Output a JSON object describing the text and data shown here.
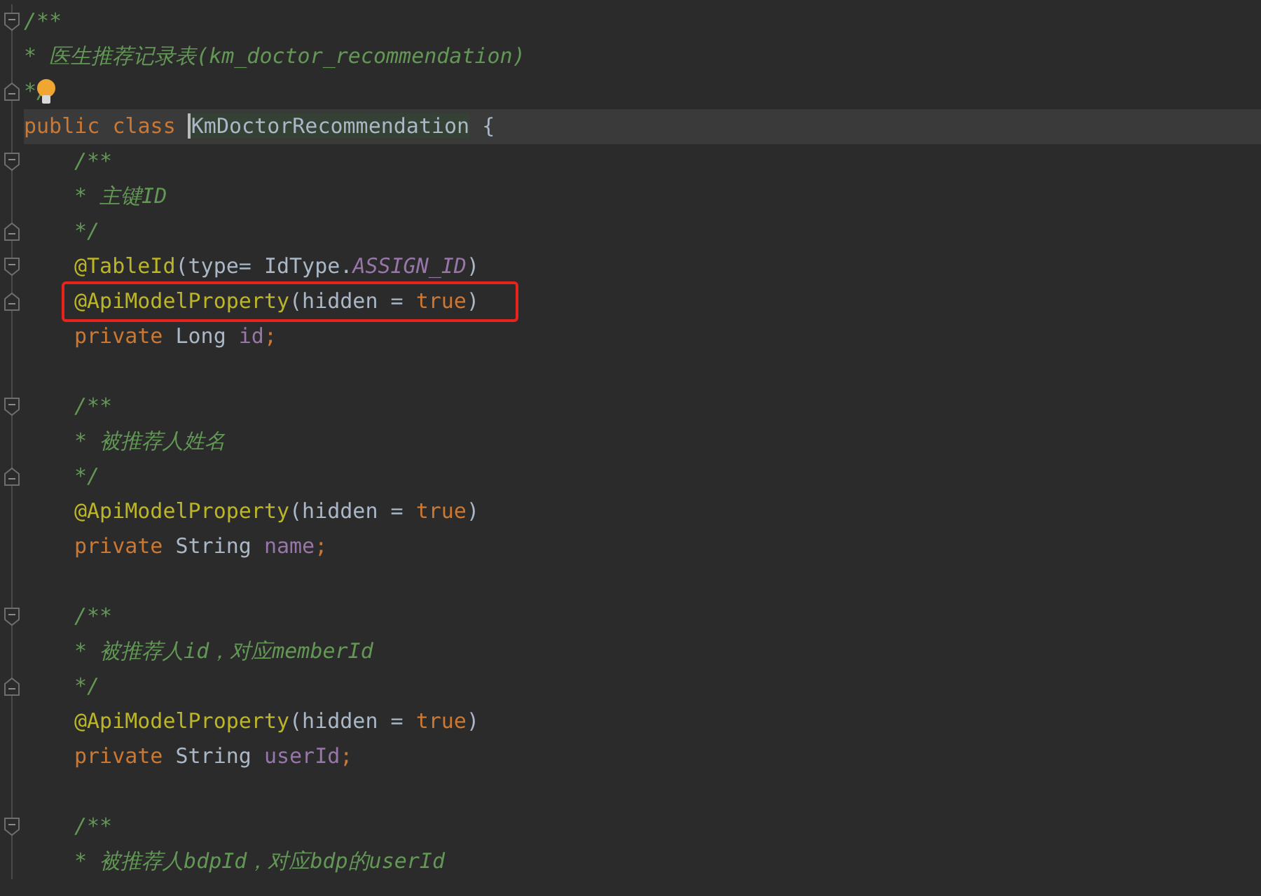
{
  "editor": {
    "lines": [
      {
        "kind": "opener",
        "tokens": [
          {
            "kind": "comment",
            "text": "/**"
          }
        ]
      },
      {
        "kind": "text",
        "tokens": [
          {
            "kind": "comment",
            "text": "* 医生推荐记录表(km_doctor_recommendation)"
          }
        ]
      },
      {
        "kind": "closer",
        "bulb": true,
        "tokens": [
          {
            "kind": "comment",
            "text": "*/"
          }
        ]
      },
      {
        "kind": "text",
        "current": true,
        "tokens": [
          {
            "kind": "keyword",
            "text": "public class "
          },
          {
            "kind": "declaration",
            "text": "KmDoctorRecommendation"
          },
          {
            "kind": "plain",
            "text": " {"
          }
        ],
        "children": [
          {
            "kind": "opener",
            "tokens": [
              {
                "kind": "comment",
                "text": "/**"
              }
            ]
          },
          {
            "kind": "text",
            "tokens": [
              {
                "kind": "comment",
                "text": "* 主键ID"
              }
            ]
          },
          {
            "kind": "closer",
            "tokens": [
              {
                "kind": "comment",
                "text": "*/"
              }
            ]
          },
          {
            "kind": "opener",
            "tokens": [
              {
                "kind": "annotation",
                "text": "@TableId"
              },
              {
                "kind": "plain",
                "text": "(type= IdType."
              },
              {
                "kind": "constant",
                "text": "ASSIGN_ID"
              },
              {
                "kind": "plain",
                "text": ")"
              }
            ]
          },
          {
            "kind": "closer",
            "boxed": true,
            "tokens": [
              {
                "kind": "annotation",
                "text": "@ApiModelProperty"
              },
              {
                "kind": "plain",
                "text": "(hidden = "
              },
              {
                "kind": "keyword",
                "text": "true"
              },
              {
                "kind": "plain",
                "text": ")"
              }
            ]
          },
          {
            "kind": "text",
            "tokens": [
              {
                "kind": "keyword",
                "text": "private "
              },
              {
                "kind": "plain",
                "text": "Long "
              },
              {
                "kind": "field",
                "text": "id"
              },
              {
                "kind": "keyword",
                "text": ";"
              }
            ]
          },
          {
            "kind": "blank"
          },
          {
            "kind": "opener",
            "tokens": [
              {
                "kind": "comment",
                "text": "/**"
              }
            ]
          },
          {
            "kind": "text",
            "tokens": [
              {
                "kind": "comment",
                "text": "* 被推荐人姓名"
              }
            ]
          },
          {
            "kind": "closer",
            "tokens": [
              {
                "kind": "comment",
                "text": "*/"
              }
            ]
          },
          {
            "kind": "text",
            "tokens": [
              {
                "kind": "annotation",
                "text": "@ApiModelProperty"
              },
              {
                "kind": "plain",
                "text": "(hidden = "
              },
              {
                "kind": "keyword",
                "text": "true"
              },
              {
                "kind": "plain",
                "text": ")"
              }
            ]
          },
          {
            "kind": "text",
            "tokens": [
              {
                "kind": "keyword",
                "text": "private "
              },
              {
                "kind": "plain",
                "text": "String "
              },
              {
                "kind": "field",
                "text": "name"
              },
              {
                "kind": "keyword",
                "text": ";"
              }
            ]
          },
          {
            "kind": "blank"
          },
          {
            "kind": "opener",
            "tokens": [
              {
                "kind": "comment",
                "text": "/**"
              }
            ]
          },
          {
            "kind": "text",
            "tokens": [
              {
                "kind": "comment",
                "text": "* 被推荐人id，对应memberId"
              }
            ]
          },
          {
            "kind": "closer",
            "tokens": [
              {
                "kind": "comment",
                "text": "*/"
              }
            ]
          },
          {
            "kind": "text",
            "tokens": [
              {
                "kind": "annotation",
                "text": "@ApiModelProperty"
              },
              {
                "kind": "plain",
                "text": "(hidden = "
              },
              {
                "kind": "keyword",
                "text": "true"
              },
              {
                "kind": "plain",
                "text": ")"
              }
            ]
          },
          {
            "kind": "text",
            "tokens": [
              {
                "kind": "keyword",
                "text": "private "
              },
              {
                "kind": "plain",
                "text": "String "
              },
              {
                "kind": "field",
                "text": "userId"
              },
              {
                "kind": "keyword",
                "text": ";"
              }
            ]
          },
          {
            "kind": "blank"
          },
          {
            "kind": "opener",
            "tokens": [
              {
                "kind": "comment",
                "text": "/**"
              }
            ]
          },
          {
            "kind": "text",
            "tokens": [
              {
                "kind": "comment",
                "text": "* 被推荐人bdpId，对应bdp的userId"
              }
            ]
          }
        ]
      }
    ]
  }
}
